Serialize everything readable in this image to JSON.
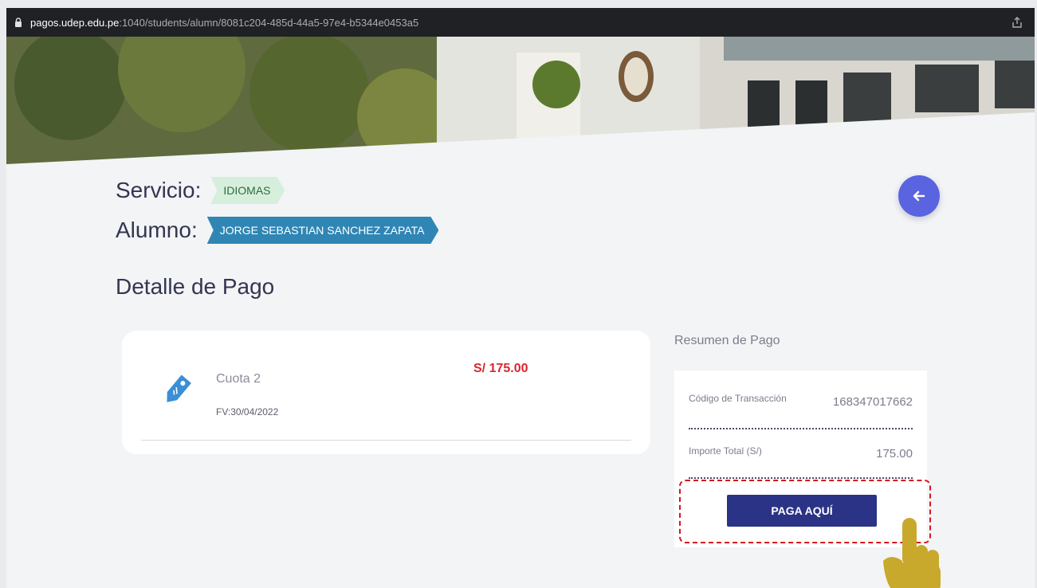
{
  "browser": {
    "url_host": "pagos.udep.edu.pe",
    "url_path": ":1040/students/alumn/8081c204-485d-44a5-97e4-b5344e0453a5"
  },
  "service": {
    "label": "Servicio:",
    "value": "IDIOMAS"
  },
  "student": {
    "label": "Alumno:",
    "value": "JORGE SEBASTIAN SANCHEZ ZAPATA"
  },
  "section_title": "Detalle de Pago",
  "payment_item": {
    "concept": "Cuota 2",
    "due": "FV:30/04/2022",
    "amount": "S/ 175.00"
  },
  "summary": {
    "title": "Resumen de Pago",
    "transaction_label": "Código de Transacción",
    "transaction_value": "168347017662",
    "total_label": "Importe Total (S/)",
    "total_value": "175.00",
    "pay_button": "PAGA AQUÍ"
  },
  "colors": {
    "accent": "#5a63e0",
    "pay_button": "#2b3386",
    "amount": "#d9272e",
    "tag_green": "#d6efdc",
    "tag_blue": "#2f86b5",
    "highlight": "#d9141c",
    "hand": "#c8a92c"
  },
  "icons": [
    "lock-icon",
    "share-icon",
    "arrow-left-icon",
    "price-tag-icon",
    "pointing-hand-icon"
  ]
}
